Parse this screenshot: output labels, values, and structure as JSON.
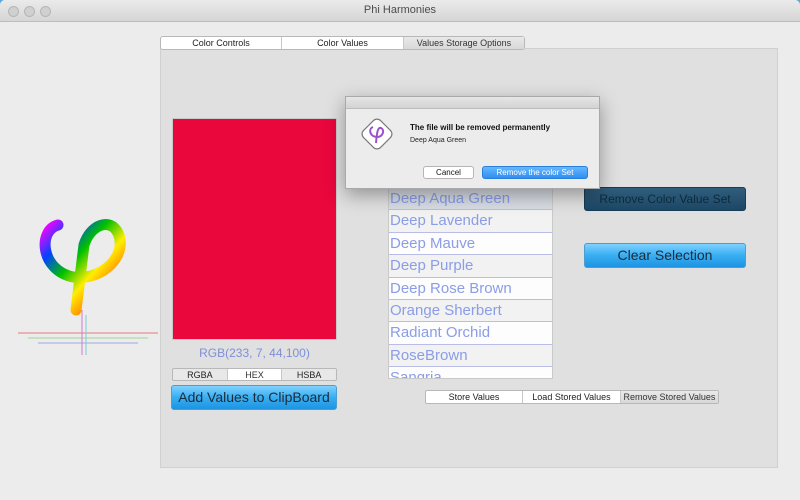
{
  "window": {
    "title": "Phi Harmonies"
  },
  "top_tabs": [
    {
      "label": "Color Controls"
    },
    {
      "label": "Color Values"
    },
    {
      "label": "Values Storage Options"
    }
  ],
  "swatch": {
    "color": "#e9073c"
  },
  "rgb_label": "RGB(233,  7, 44,100)",
  "format_tabs": [
    {
      "label": "RGBA"
    },
    {
      "label": "HEX"
    },
    {
      "label": "HSBA"
    }
  ],
  "buttons": {
    "add_clipboard": "Add Values to ClipBoard",
    "remove_set": "Remove Color Value Set",
    "clear_selection": "Clear Selection"
  },
  "color_sets": [
    "Deep Aqua Green",
    "Deep Lavender",
    "Deep Mauve",
    "Deep Purple",
    "Deep Rose Brown",
    "Orange Sherbert",
    "Radiant Orchid",
    "RoseBrown",
    "Sangria"
  ],
  "bottom_tabs": [
    {
      "label": "Store Values"
    },
    {
      "label": "Load Stored Values"
    },
    {
      "label": "Remove Stored Values"
    }
  ],
  "dialog": {
    "title": "The file will be removed permanently",
    "message": "Deep Aqua Green",
    "cancel": "Cancel",
    "confirm": "Remove the color Set"
  }
}
